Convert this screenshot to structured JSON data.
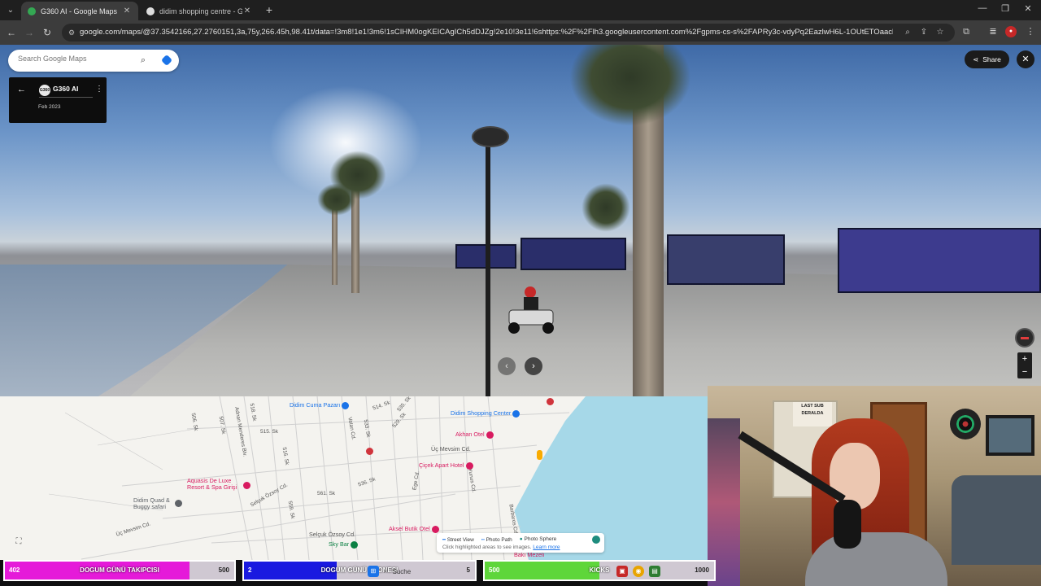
{
  "browser": {
    "tabs": [
      {
        "title": "G360 AI - Google Maps",
        "active": true
      },
      {
        "title": "didim shopping centre - Google",
        "active": false
      }
    ],
    "url": "google.com/maps/@37.3542166,27.2760151,3a,75y,266.45h,98.41t/data=!3m8!1e1!3m6!1sCIHM0ogKEICAgICh5dDJZg!2e10!3e11!6shttps:%2F%2Flh3.googleusercontent.com%2Fgpms-cs-s%2FAPRy3c-vdyPq2EazlwH6L-1OUtETOaacleYPuyCqoRgAMqgCRgMm..."
  },
  "streetview": {
    "search_placeholder": "Search Google Maps",
    "contributor": {
      "avatar_text": "G360",
      "name": "G360 AI",
      "date": "Feb 2023"
    },
    "share_label": "Share"
  },
  "map": {
    "pois": [
      {
        "label": "Didim Cuma Pazarı",
        "color": "#1a73e8"
      },
      {
        "label": "Didim Shopping Center",
        "color": "#1a73e8"
      },
      {
        "label": "Akhan Otel",
        "color": "#d81b60"
      },
      {
        "label": "Üç Mevsim Cd.",
        "color": "#555"
      },
      {
        "label": "Çiçek Apart Hotel",
        "color": "#d81b60"
      },
      {
        "label": "Aquasis De Luxe Resort & Spa Girişi",
        "color": "#d81b60"
      },
      {
        "label": "Didim Quad & Buggy safari",
        "color": "#5f6368"
      },
      {
        "label": "Aksel Butik Otel",
        "color": "#d81b60"
      },
      {
        "label": "Sky Bar",
        "color": "#0b8043"
      },
      {
        "label": "Selçuk Özsoy Cd.",
        "color": "#555"
      }
    ],
    "streets": [
      "506. Sk",
      "507. Sk",
      "Adnan Menderes Blv.",
      "518. Sk",
      "515. Sk",
      "514. Sk",
      "Vatan Cd.",
      "533. Sk",
      "529. Sk",
      "535. Sk",
      "516. Sk",
      "536. Sk",
      "561. Sk",
      "559. Sk",
      "Üç Mevsim Cd.",
      "Ege Cd.",
      "Yunus Cd.",
      "Selçuk Özsoy Cd.",
      "Barbaros Cd."
    ],
    "layers": {
      "items": [
        "Street View",
        "Photo Path",
        "Photo Sphere"
      ],
      "hint": "Click highlighted areas to see images.",
      "learn_more": "Learn more"
    },
    "partial_label": "Bakı Mezeli"
  },
  "webcam": {
    "sign_text": [
      "LAST SUB",
      "DERALDA"
    ]
  },
  "goals": [
    {
      "current": "402",
      "label": "DOGUM GÜNÜ TAKIPCISI",
      "max": "500",
      "progress": 0.804,
      "color": "#e51ad9"
    },
    {
      "current": "2",
      "label": "DOGUM GÜNÜ ABONESI",
      "max": "5",
      "progress": 0.4,
      "color": "#1a1ae0"
    },
    {
      "current": "500",
      "label": "KICKS",
      "max": "1000",
      "progress": 0.5,
      "color": "#5ed63a"
    }
  ],
  "taskbar": {
    "search_label": "Suche"
  }
}
